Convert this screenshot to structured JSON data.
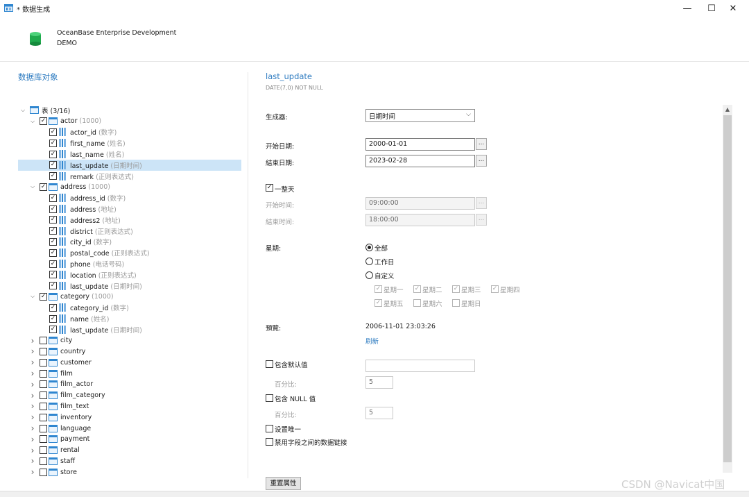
{
  "window": {
    "title": "* 数据生成",
    "controls": {
      "minimize": "—",
      "maximize": "☐",
      "close": "✕"
    }
  },
  "header": {
    "connection": "OceanBase Enterprise Development",
    "database": "DEMO"
  },
  "left": {
    "title": "数据库对象"
  },
  "tree": [
    {
      "level": 0,
      "expander": "down",
      "checkbox": null,
      "icon": "table",
      "label": "表",
      "hint": "(3/16)",
      "hint_style": "plain"
    },
    {
      "level": 1,
      "expander": "down",
      "checkbox": "checked",
      "icon": "table",
      "label": "actor",
      "hint": "(1000)"
    },
    {
      "level": 2,
      "checkbox": "checked",
      "icon": "column",
      "label": "actor_id",
      "hint": "(数字)"
    },
    {
      "level": 2,
      "checkbox": "checked",
      "icon": "column",
      "label": "first_name",
      "hint": "(姓名)"
    },
    {
      "level": 2,
      "checkbox": "checked",
      "icon": "column",
      "label": "last_name",
      "hint": "(姓名)"
    },
    {
      "level": 2,
      "checkbox": "checked",
      "icon": "column",
      "label": "last_update",
      "hint": "(日期时间)",
      "selected": true
    },
    {
      "level": 2,
      "checkbox": "checked",
      "icon": "column",
      "label": "remark",
      "hint": "(正则表达式)"
    },
    {
      "level": 1,
      "expander": "down",
      "checkbox": "checked",
      "icon": "table",
      "label": "address",
      "hint": "(1000)"
    },
    {
      "level": 2,
      "checkbox": "checked",
      "icon": "column",
      "label": "address_id",
      "hint": "(数字)"
    },
    {
      "level": 2,
      "checkbox": "checked",
      "icon": "column",
      "label": "address",
      "hint": "(地址)"
    },
    {
      "level": 2,
      "checkbox": "checked",
      "icon": "column",
      "label": "address2",
      "hint": "(地址)"
    },
    {
      "level": 2,
      "checkbox": "checked",
      "icon": "column",
      "label": "district",
      "hint": "(正则表达式)"
    },
    {
      "level": 2,
      "checkbox": "checked",
      "icon": "column",
      "label": "city_id",
      "hint": "(数字)"
    },
    {
      "level": 2,
      "checkbox": "checked",
      "icon": "column",
      "label": "postal_code",
      "hint": "(正则表达式)"
    },
    {
      "level": 2,
      "checkbox": "checked",
      "icon": "column",
      "label": "phone",
      "hint": "(电话号码)"
    },
    {
      "level": 2,
      "checkbox": "checked",
      "icon": "column",
      "label": "location",
      "hint": "(正则表达式)"
    },
    {
      "level": 2,
      "checkbox": "checked",
      "icon": "column",
      "label": "last_update",
      "hint": "(日期时间)"
    },
    {
      "level": 1,
      "expander": "down",
      "checkbox": "checked",
      "icon": "table",
      "label": "category",
      "hint": "(1000)"
    },
    {
      "level": 2,
      "checkbox": "checked",
      "icon": "column",
      "label": "category_id",
      "hint": "(数字)"
    },
    {
      "level": 2,
      "checkbox": "checked",
      "icon": "column",
      "label": "name",
      "hint": "(姓名)"
    },
    {
      "level": 2,
      "checkbox": "checked",
      "icon": "column",
      "label": "last_update",
      "hint": "(日期时间)"
    },
    {
      "level": 1,
      "expander": "right",
      "checkbox": "unchecked",
      "icon": "table",
      "label": "city",
      "hint": ""
    },
    {
      "level": 1,
      "expander": "right",
      "checkbox": "unchecked",
      "icon": "table",
      "label": "country",
      "hint": ""
    },
    {
      "level": 1,
      "expander": "right",
      "checkbox": "unchecked",
      "icon": "table",
      "label": "customer",
      "hint": ""
    },
    {
      "level": 1,
      "expander": "right",
      "checkbox": "unchecked",
      "icon": "table",
      "label": "film",
      "hint": ""
    },
    {
      "level": 1,
      "expander": "right",
      "checkbox": "unchecked",
      "icon": "table",
      "label": "film_actor",
      "hint": ""
    },
    {
      "level": 1,
      "expander": "right",
      "checkbox": "unchecked",
      "icon": "table",
      "label": "film_category",
      "hint": ""
    },
    {
      "level": 1,
      "expander": "right",
      "checkbox": "unchecked",
      "icon": "table",
      "label": "film_text",
      "hint": ""
    },
    {
      "level": 1,
      "expander": "right",
      "checkbox": "unchecked",
      "icon": "table",
      "label": "inventory",
      "hint": ""
    },
    {
      "level": 1,
      "expander": "right",
      "checkbox": "unchecked",
      "icon": "table",
      "label": "language",
      "hint": ""
    },
    {
      "level": 1,
      "expander": "right",
      "checkbox": "unchecked",
      "icon": "table",
      "label": "payment",
      "hint": ""
    },
    {
      "level": 1,
      "expander": "right",
      "checkbox": "unchecked",
      "icon": "table",
      "label": "rental",
      "hint": ""
    },
    {
      "level": 1,
      "expander": "right",
      "checkbox": "unchecked",
      "icon": "table",
      "label": "staff",
      "hint": ""
    },
    {
      "level": 1,
      "expander": "right",
      "checkbox": "unchecked",
      "icon": "table",
      "label": "store",
      "hint": ""
    }
  ],
  "field": {
    "name": "last_update",
    "type": "DATE(7,0) NOT NULL"
  },
  "generator": {
    "label": "生成器:",
    "value": "日期时间"
  },
  "dates": {
    "start_label": "开始日期:",
    "start_value": "2000-01-01",
    "end_label": "結束日期:",
    "end_value": "2023-02-28",
    "browse": "..."
  },
  "all_day": {
    "label": "一整天",
    "checked": true,
    "start_time_label": "开始时间:",
    "start_time_value": "09:00:00",
    "end_time_label": "結束时间:",
    "end_time_value": "18:00:00"
  },
  "week": {
    "label": "星期:",
    "options": [
      "全部",
      "工作日",
      "自定义"
    ],
    "selected": "全部",
    "days": [
      {
        "label": "星期一",
        "checked": true
      },
      {
        "label": "星期二",
        "checked": true
      },
      {
        "label": "星期三",
        "checked": true
      },
      {
        "label": "星期四",
        "checked": true
      },
      {
        "label": "星期五",
        "checked": true
      },
      {
        "label": "星期六",
        "checked": false
      },
      {
        "label": "星期日",
        "checked": false
      }
    ]
  },
  "preview": {
    "label": "預覽:",
    "value": "2006-11-01 23:03:26",
    "refresh": "刷新"
  },
  "options": {
    "include_default_label": "包含默认值",
    "include_default_value": "",
    "percent_label": "百分比:",
    "default_percent": "5",
    "include_null_label": "包含 NULL 值",
    "null_percent": "5",
    "unique_label": "设置唯一",
    "disable_link_label": "禁用字段之间的数据链接"
  },
  "reset_button": "重置属性",
  "watermark": "CSDN @Navicat中国",
  "colors": {
    "accent": "#2f7cc1",
    "selection": "#cce4f7",
    "table_icon": "#2f86d0"
  }
}
